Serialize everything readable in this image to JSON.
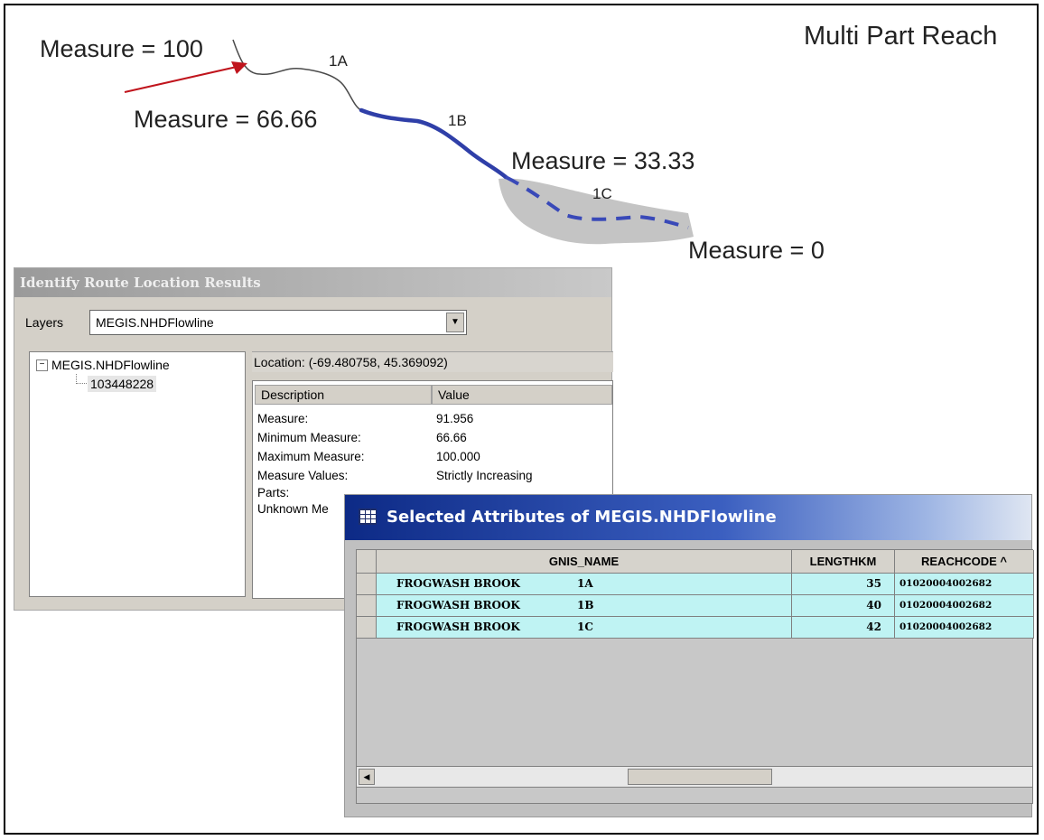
{
  "diagram": {
    "title": "Multi Part Reach",
    "measure_labels": [
      "Measure = 100",
      "Measure = 66.66",
      "Measure = 33.33",
      "Measure = 0"
    ],
    "part_labels": [
      "1A",
      "1B",
      "1C"
    ]
  },
  "identify": {
    "title": "Identify Route Location Results",
    "layers_label": "Layers",
    "layer_value": "MEGIS.NHDFlowline",
    "tree_root": "MEGIS.NHDFlowline",
    "tree_child": "103448228",
    "location": "Location: (-69.480758, 45.369092)",
    "col_description": "Description",
    "col_value": "Value",
    "rows": [
      {
        "label": "Measure:",
        "value": "91.956"
      },
      {
        "label": "Minimum Measure:",
        "value": "66.66"
      },
      {
        "label": "Maximum Measure:",
        "value": "100.000"
      },
      {
        "label": "Measure Values:",
        "value": "Strictly Increasing"
      },
      {
        "label": "Parts:",
        "value": ""
      },
      {
        "label": "Unknown Me",
        "value": ""
      }
    ]
  },
  "selected": {
    "title": "Selected Attributes of MEGIS.NHDFlowline",
    "columns": [
      "GNIS_NAME",
      "LENGTHKM",
      "REACHCODE ^"
    ],
    "rows": [
      {
        "name": "FROGWASH BROOK",
        "part": "1A",
        "length": "35",
        "reachcode": "01020004002682"
      },
      {
        "name": "FROGWASH BROOK",
        "part": "1B",
        "length": "40",
        "reachcode": "01020004002682"
      },
      {
        "name": "FROGWASH BROOK",
        "part": "1C",
        "length": "42",
        "reachcode": "01020004002682"
      }
    ]
  },
  "colors": {
    "stream": "#4a4a4a",
    "part_1b": "#2f3fa8",
    "part_1c": "#3949b8",
    "highlight": "#c4c4c4",
    "arrow": "#c0141c",
    "grid_cell": "#bff3f3",
    "title_bar": "#0d2a86"
  }
}
